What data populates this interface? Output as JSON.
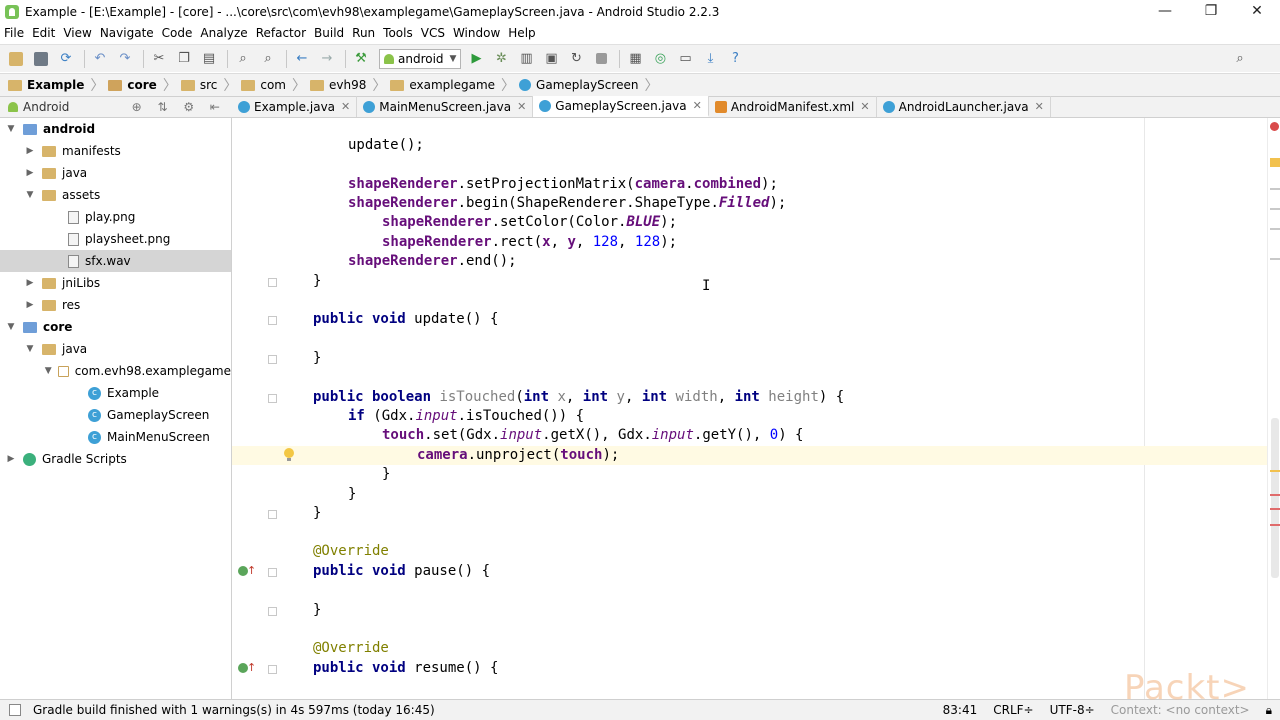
{
  "window": {
    "title": "Example - [E:\\Example] - [core] - ...\\core\\src\\com\\evh98\\examplegame\\GameplayScreen.java - Android Studio 2.2.3",
    "controls": [
      "—",
      "❐",
      "✕"
    ]
  },
  "menu": [
    "File",
    "Edit",
    "View",
    "Navigate",
    "Code",
    "Analyze",
    "Refactor",
    "Build",
    "Run",
    "Tools",
    "VCS",
    "Window",
    "Help"
  ],
  "toolbar": {
    "run_config": "android"
  },
  "breadcrumbs": [
    "Example",
    "core",
    "src",
    "com",
    "evh98",
    "examplegame",
    "GameplayScreen"
  ],
  "sidebar": {
    "view": "Android",
    "tree": [
      {
        "label": "android",
        "bold": true
      },
      {
        "label": "manifests"
      },
      {
        "label": "java"
      },
      {
        "label": "assets"
      },
      {
        "label": "play.png"
      },
      {
        "label": "playsheet.png"
      },
      {
        "label": "sfx.wav"
      },
      {
        "label": "jniLibs"
      },
      {
        "label": "res"
      },
      {
        "label": "core",
        "bold": true
      },
      {
        "label": "java"
      },
      {
        "label": "com.evh98.examplegame"
      },
      {
        "label": "Example"
      },
      {
        "label": "GameplayScreen"
      },
      {
        "label": "MainMenuScreen"
      },
      {
        "label": "Gradle Scripts"
      }
    ]
  },
  "tabs": [
    "Example.java",
    "MainMenuScreen.java",
    "GameplayScreen.java",
    "AndroidManifest.xml",
    "AndroidLauncher.java"
  ],
  "editor": {
    "lines": [
      "update();",
      "",
      "shapeRenderer.setProjectionMatrix(camera.combined);",
      "shapeRenderer.begin(ShapeRenderer.ShapeType.Filled);",
      "shapeRenderer.setColor(Color.BLUE);",
      "shapeRenderer.rect(x, y, 128, 128);",
      "shapeRenderer.end();",
      "}",
      "",
      "public void update() {",
      "",
      "}",
      "",
      "public boolean isTouched(int x, int y, int width, int height) {",
      "if (Gdx.input.isTouched()) {",
      "touch.set(Gdx.input.getX(), Gdx.input.getY(), 0) {",
      "camera.unproject(touch);",
      "}",
      "}",
      "}",
      "",
      "@Override",
      "public void pause() {",
      "",
      "}",
      "",
      "@Override",
      "public void resume() {"
    ]
  },
  "status": {
    "message": "Gradle build finished with 1 warnings(s) in 4s 597ms (today 16:45)",
    "position": "83:41",
    "line_sep": "CRLF÷",
    "encoding": "UTF-8÷",
    "context": "Context: <no context>"
  },
  "watermark": "Packt>"
}
